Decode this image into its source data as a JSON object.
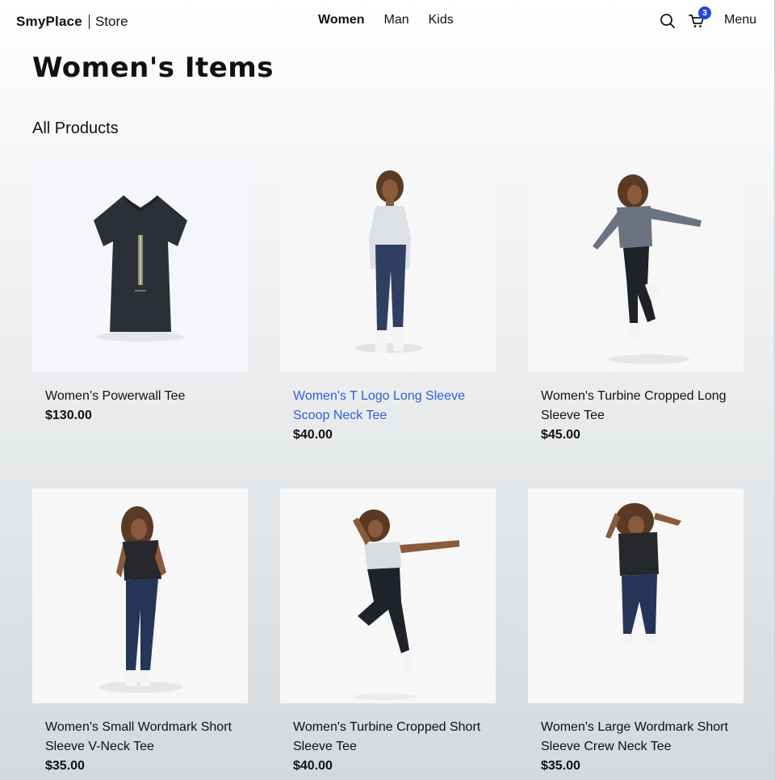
{
  "header": {
    "brand": "SmyPlace",
    "store_label": "Store",
    "nav": [
      {
        "label": "Women",
        "active": true
      },
      {
        "label": "Man",
        "active": false
      },
      {
        "label": "Kids",
        "active": false
      }
    ],
    "search_icon": "search-icon",
    "cart_icon": "cart-icon",
    "cart_count": "3",
    "menu_label": "Menu",
    "accent_color": "#2446d9"
  },
  "main": {
    "title": "Women's Items",
    "section_title": "All Products",
    "products": [
      {
        "name": "Women’s Powerwall Tee",
        "price": "$130.00",
        "image": "black v-neck tee"
      },
      {
        "name": "Women's T Logo Long Sleeve Scoop Neck Tee",
        "price": "$40.00",
        "image": "model in white long sleeve",
        "hover": true
      },
      {
        "name": "Women's Turbine Cropped Long Sleeve Tee",
        "price": "$45.00",
        "image": "model in grey long sleeve jumping"
      },
      {
        "name": "Women's Small Wordmark Short Sleeve V-Neck Tee",
        "price": "$35.00",
        "image": "model in black v-neck"
      },
      {
        "name": "Women's Turbine Cropped Short Sleeve Tee",
        "price": "$40.00",
        "image": "model in white tee jumping"
      },
      {
        "name": "Women's Large Wordmark Short Sleeve Crew Neck Tee",
        "price": "$35.00",
        "image": "model in black crew neck jumping"
      }
    ]
  }
}
